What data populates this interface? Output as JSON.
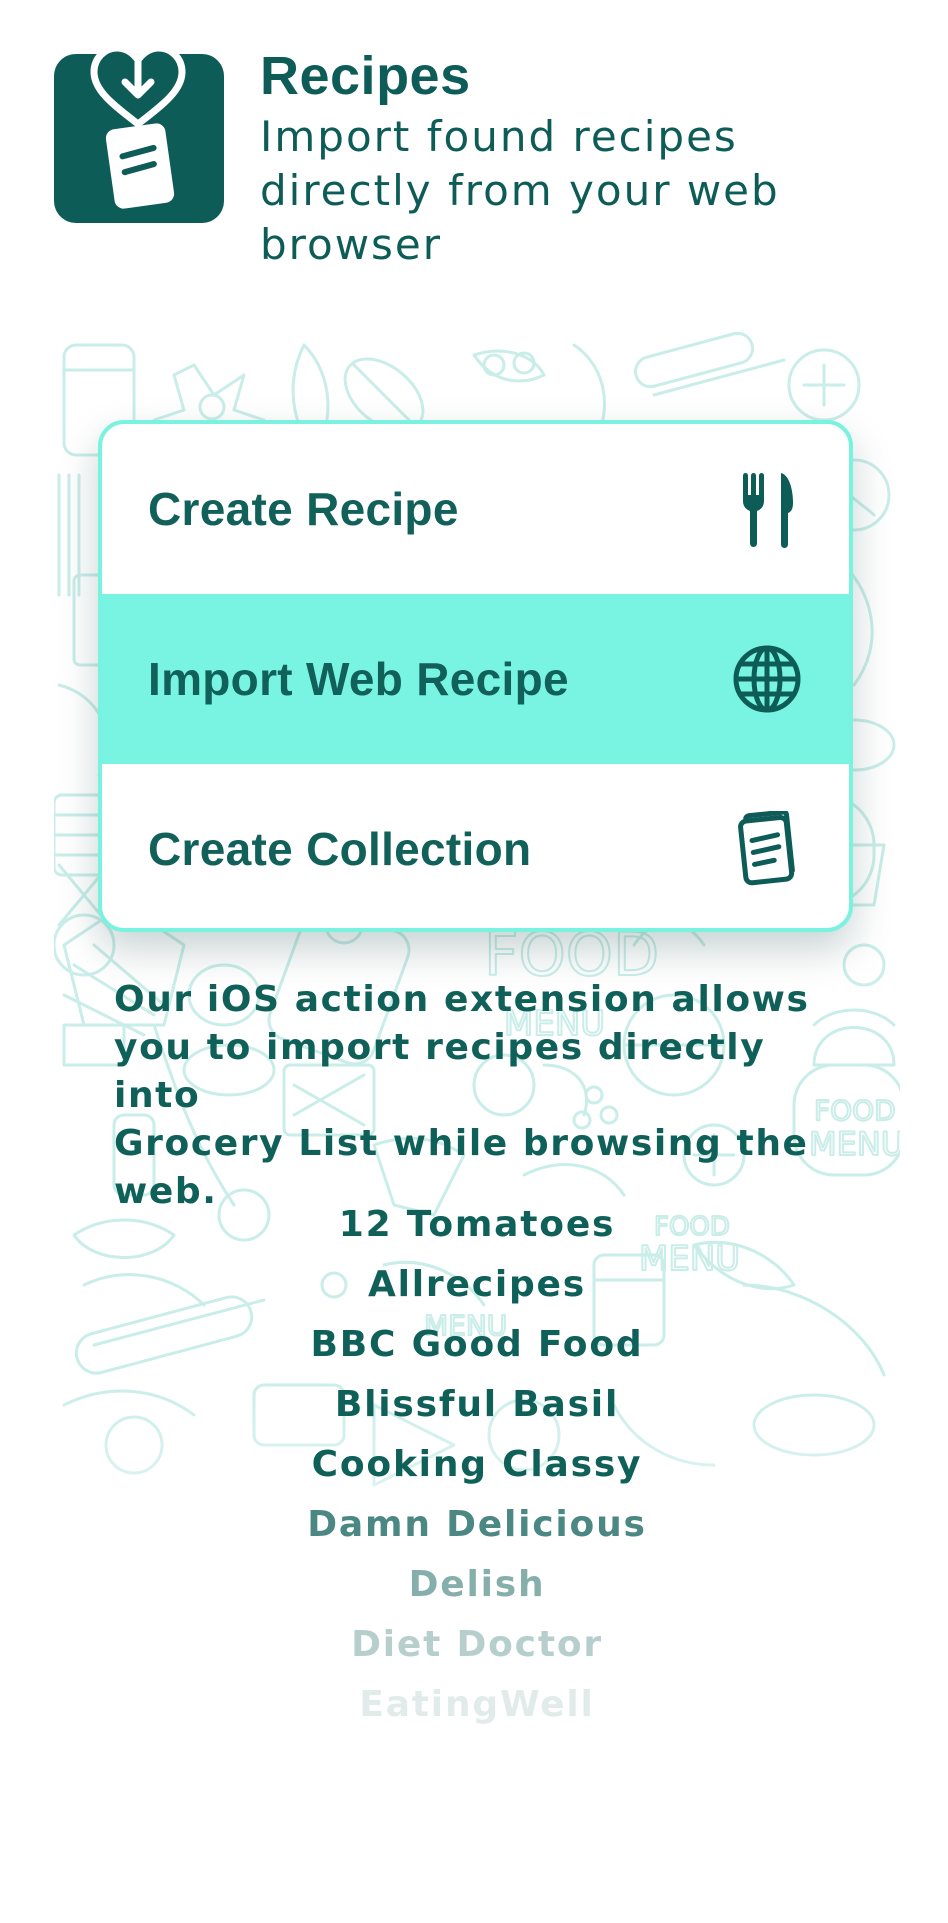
{
  "header": {
    "icon": "recipe-import-app-icon",
    "title": "Recipes",
    "subtitle_lines": [
      "Import found recipes",
      "directly from your web",
      "browser"
    ]
  },
  "menu": {
    "items": [
      {
        "label": "Create Recipe",
        "icon": "fork-knife-icon",
        "highlighted": false
      },
      {
        "label": "Import Web Recipe",
        "icon": "globe-icon",
        "highlighted": true
      },
      {
        "label": "Create Collection",
        "icon": "collection-book-icon",
        "highlighted": false
      }
    ]
  },
  "description": {
    "lines": [
      "Our iOS action extension allows",
      "you to import recipes directly into",
      "Grocery List while browsing the",
      "web."
    ]
  },
  "sites": {
    "items": [
      "12 Tomatoes",
      "Allrecipes",
      "BBC Good Food",
      "Blissful Basil",
      "Cooking Classy",
      "Damn Delicious",
      "Delish",
      "Diet Doctor",
      "EatingWell"
    ],
    "opacity": [
      1,
      1,
      1,
      1,
      1,
      0.75,
      0.5,
      0.3,
      0.12
    ]
  },
  "colors": {
    "brand_dark": "#0e5c57",
    "accent_mint": "#79f4e2",
    "doodle_line": "#c7ece7"
  }
}
